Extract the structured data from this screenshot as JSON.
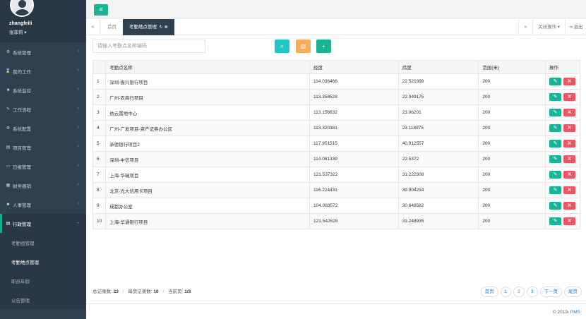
{
  "sidebar": {
    "username": "zhangfeili",
    "user_role": "张菲莉 ▾",
    "items": [
      {
        "label": "系统管理",
        "icon": "gear-icon",
        "glyph": "⚙"
      },
      {
        "label": "我的工作",
        "icon": "hourglass-icon",
        "glyph": "⌛"
      },
      {
        "label": "系统监控",
        "icon": "video-icon",
        "glyph": "■"
      },
      {
        "label": "工作流程",
        "icon": "wrench-icon",
        "glyph": "✎"
      },
      {
        "label": "系统配置",
        "icon": "cogs-icon",
        "glyph": "⚙"
      },
      {
        "label": "项目管理",
        "icon": "folder-icon",
        "glyph": "▤"
      },
      {
        "label": "日报管理",
        "icon": "laptop-icon",
        "glyph": "▭"
      },
      {
        "label": "财务报销",
        "icon": "list-icon",
        "glyph": "▦"
      },
      {
        "label": "人事管理",
        "icon": "users-icon",
        "glyph": "☻"
      },
      {
        "label": "行政管理",
        "icon": "list-alt-icon",
        "glyph": "▤"
      }
    ],
    "subitems": [
      {
        "label": "考勤组管理"
      },
      {
        "label": "考勤地点管理"
      },
      {
        "label": "职员年假"
      },
      {
        "label": "公告管理"
      }
    ]
  },
  "tabs": {
    "home": "首页",
    "active": "考勤地点管理",
    "close_ops": "关闭操作 ▾",
    "logout": "退出"
  },
  "search": {
    "placeholder": "请输入考勤点名称编码"
  },
  "table": {
    "headers": [
      "",
      "考勤点名称",
      "经度",
      "纬度",
      "范围(米)",
      "操作"
    ],
    "rows": [
      {
        "idx": "1",
        "name": "深圳-振兴银行项目",
        "lng": "114.036466",
        "lat": "22.520398",
        "range": "200"
      },
      {
        "idx": "2",
        "name": "广州-农商行项目",
        "lng": "113.358528",
        "lat": "22.949175",
        "range": "200"
      },
      {
        "idx": "3",
        "name": "依云置地中心",
        "lng": "113.156632",
        "lat": "23.06201",
        "range": "200"
      },
      {
        "idx": "4",
        "name": "广州-广发项目-资产证券办公区",
        "lng": "113.320381",
        "lat": "23.118975",
        "range": "200"
      },
      {
        "idx": "5",
        "name": "承德银行项目2",
        "lng": "117.951515",
        "lat": "40.912557",
        "range": "200"
      },
      {
        "idx": "6",
        "name": "深圳-中信项目",
        "lng": "114.081339",
        "lat": "22.5372",
        "range": "200"
      },
      {
        "idx": "7",
        "name": "上海-华瑞项目",
        "lng": "121.537322",
        "lat": "31.222308",
        "range": "200"
      },
      {
        "idx": "8",
        "name": "北京-光大信用卡项目",
        "lng": "116.224431",
        "lat": "39.904234",
        "range": "200"
      },
      {
        "idx": "9",
        "name": "成都办公室",
        "lng": "104.083572",
        "lat": "30.648582",
        "range": "200"
      },
      {
        "idx": "10",
        "name": "上海-华通银行项目",
        "lng": "121.542628",
        "lat": "31.248935",
        "range": "200"
      }
    ]
  },
  "pagination": {
    "total_label": "总记录数: ",
    "total": "23",
    "per_page_label": "每页记录数: ",
    "per_page": "10",
    "current_label": "当前页: ",
    "current": "1/3",
    "first": "首页",
    "pages": [
      "1",
      "2",
      "3"
    ],
    "next": "下一页",
    "last": "尾页"
  },
  "footer": {
    "copyright": "© 2019- ",
    "brand": "PMS"
  },
  "colors": {
    "primary": "#1ab394",
    "info": "#23c6c8",
    "warning": "#f8ac59",
    "danger": "#ed5565",
    "sidebar_bg": "#2f4050"
  }
}
